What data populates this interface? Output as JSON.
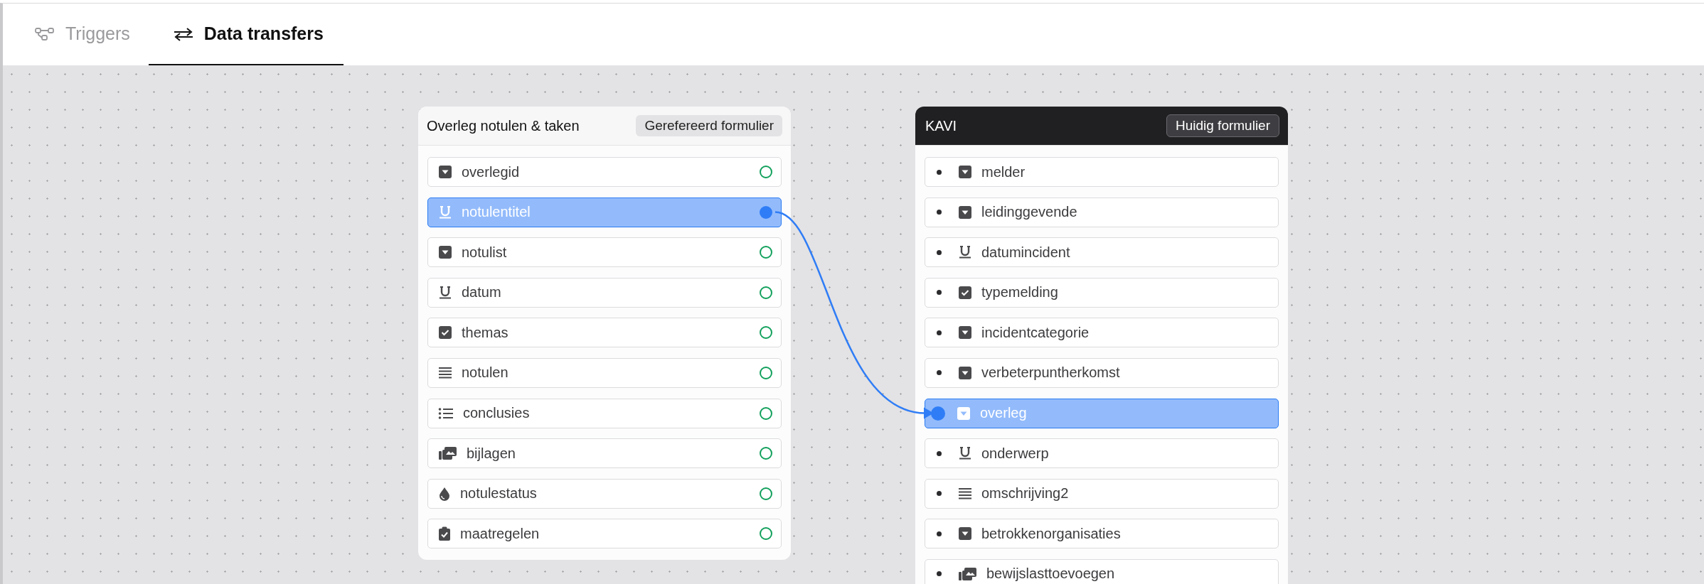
{
  "tabs": [
    {
      "label": "Triggers",
      "kind": "flow",
      "selected": false
    },
    {
      "label": "Data transfers",
      "kind": "transfer",
      "selected": true
    }
  ],
  "cards": [
    {
      "kind": "referenced",
      "title": "Overleg notulen & taken",
      "badge": "Gerefereerd formulier",
      "fields": [
        {
          "label": "overlegid",
          "kind": "dropdown",
          "selected": false
        },
        {
          "label": "notulentitel",
          "kind": "text",
          "selected": true
        },
        {
          "label": "notulist",
          "kind": "dropdown",
          "selected": false
        },
        {
          "label": "datum",
          "kind": "text",
          "selected": false
        },
        {
          "label": "themas",
          "kind": "checkbox",
          "selected": false
        },
        {
          "label": "notulen",
          "kind": "textarea",
          "selected": false
        },
        {
          "label": "conclusies",
          "kind": "list",
          "selected": false
        },
        {
          "label": "bijlagen",
          "kind": "media",
          "selected": false
        },
        {
          "label": "notulestatus",
          "kind": "status",
          "selected": false
        },
        {
          "label": "maatregelen",
          "kind": "task",
          "selected": false
        }
      ]
    },
    {
      "kind": "current",
      "title": "KAVI",
      "badge": "Huidig formulier",
      "fields": [
        {
          "label": "melder",
          "kind": "dropdown",
          "selected": false
        },
        {
          "label": "leidinggevende",
          "kind": "dropdown",
          "selected": false
        },
        {
          "label": "datumincident",
          "kind": "text",
          "selected": false
        },
        {
          "label": "typemelding",
          "kind": "checkbox",
          "selected": false
        },
        {
          "label": "incidentcategorie",
          "kind": "dropdown",
          "selected": false
        },
        {
          "label": "verbeterpuntherkomst",
          "kind": "dropdown",
          "selected": false
        },
        {
          "label": "overleg",
          "kind": "dropdown",
          "selected": true
        },
        {
          "label": "onderwerp",
          "kind": "text",
          "selected": false
        },
        {
          "label": "omschrijving2",
          "kind": "textarea",
          "selected": false
        },
        {
          "label": "betrokkenorganisaties",
          "kind": "dropdown",
          "selected": false
        },
        {
          "label": "bewijslasttoevoegen",
          "kind": "media",
          "selected": false
        }
      ]
    }
  ]
}
